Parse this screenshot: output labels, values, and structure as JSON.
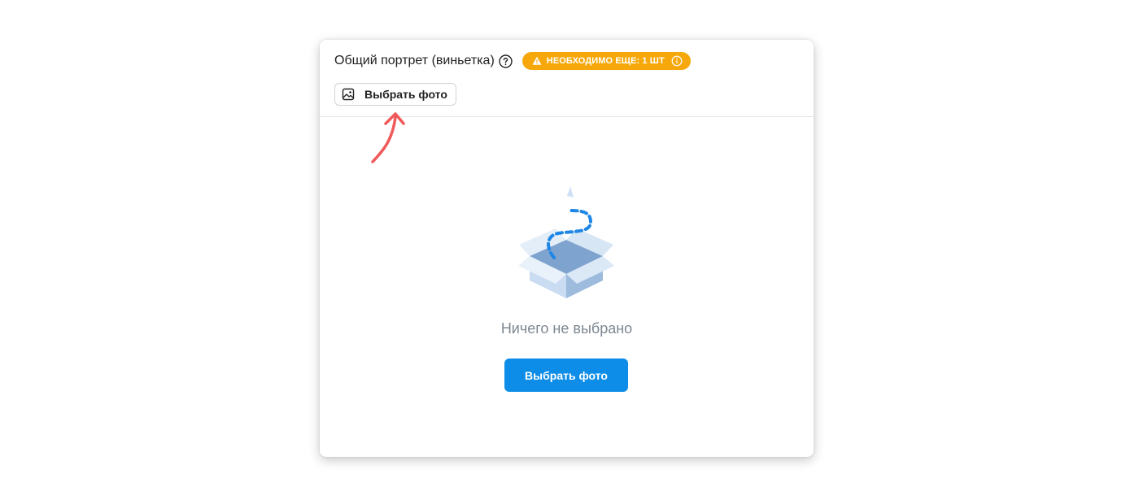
{
  "header": {
    "title": "Общий портрет (виньетка)",
    "help_icon": "question-circle-icon",
    "warning_badge": {
      "text": "НЕОБХОДИМО ЕЩЕ: 1 ШТ",
      "icon": "warning-triangle-icon",
      "info_icon": "info-circle-icon",
      "color": "#f6a80b"
    },
    "choose_button": {
      "label": "Выбрать фото",
      "icon": "image-icon"
    }
  },
  "empty_state": {
    "illustration": "open-box-illustration",
    "text": "Ничего не выбрано",
    "button_label": "Выбрать фото",
    "button_color": "#0d8de8"
  },
  "annotation": {
    "arrow": "red-arrow-annotation",
    "color": "#f05a5a"
  }
}
